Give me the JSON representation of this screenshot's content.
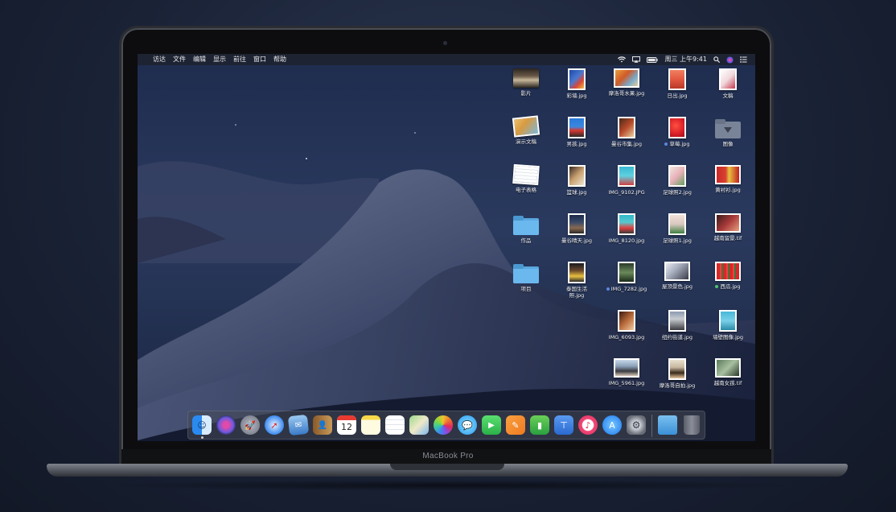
{
  "device": {
    "brand": "MacBook Pro"
  },
  "menubar": {
    "apple_icon": "apple-icon",
    "items": [
      "访达",
      "文件",
      "编辑",
      "显示",
      "前往",
      "窗口",
      "帮助"
    ],
    "status_icons": [
      "wifi-icon",
      "airplay-icon",
      "battery-icon"
    ],
    "clock": "周三 上午9:41",
    "right_icons": [
      "spotlight-icon",
      "siri-icon",
      "notification-center-icon"
    ]
  },
  "desktop": {
    "items": [
      {
        "label": "影片",
        "kind": "stack-movie"
      },
      {
        "label": "彩墙.jpg",
        "kind": "photo"
      },
      {
        "label": "摩洛哥水果.jpg",
        "kind": "photo"
      },
      {
        "label": "日出.jpg",
        "kind": "photo"
      },
      {
        "label": "文稿",
        "kind": "stack-docs"
      },
      {
        "label": "演示文稿",
        "kind": "stack-slides"
      },
      {
        "label": "男孩.jpg",
        "kind": "photo"
      },
      {
        "label": "曼谷市集.jpg",
        "kind": "photo"
      },
      {
        "label": "草莓.jpg",
        "kind": "photo",
        "tag": "#5a86e0"
      },
      {
        "label": "图像",
        "kind": "stack-images"
      },
      {
        "label": "电子表格",
        "kind": "stack-sheets"
      },
      {
        "label": "篮球.jpg",
        "kind": "photo"
      },
      {
        "label": "IMG_9102.JPG",
        "kind": "photo"
      },
      {
        "label": "足球照2.jpg",
        "kind": "photo"
      },
      {
        "label": "黄衬衫.jpg",
        "kind": "photo"
      },
      {
        "label": "作品",
        "kind": "folder"
      },
      {
        "label": "曼谷晴天.jpg",
        "kind": "photo"
      },
      {
        "label": "IMG_8120.jpg",
        "kind": "photo"
      },
      {
        "label": "足球照1.jpg",
        "kind": "photo"
      },
      {
        "label": "越南留景.tif",
        "kind": "photo"
      },
      {
        "label": "项目",
        "kind": "folder"
      },
      {
        "label": "泰国生活照.jpg",
        "kind": "photo"
      },
      {
        "label": "IMG_7282.jpg",
        "kind": "photo",
        "tag": "#5a86e0"
      },
      {
        "label": "屋顶景色.jpg",
        "kind": "photo"
      },
      {
        "label": "西瓜.jpg",
        "kind": "photo",
        "tag": "#4cc46a"
      },
      {
        "label": "IMG_6093.jpg",
        "kind": "photo"
      },
      {
        "label": "纽约街道.jpg",
        "kind": "photo"
      },
      {
        "label": "墙壁图像.jpg",
        "kind": "photo"
      },
      {
        "label": "IMG_5961.jpg",
        "kind": "photo"
      },
      {
        "label": "摩洛哥自拍.jpg",
        "kind": "photo"
      },
      {
        "label": "越南女孩.tif",
        "kind": "photo"
      }
    ]
  },
  "dock": {
    "apps": [
      "finder-icon",
      "siri-icon",
      "launchpad-icon",
      "safari-icon",
      "mail-icon",
      "contacts-icon",
      "calendar-icon",
      "notes-icon",
      "reminders-icon",
      "maps-icon",
      "photos-icon",
      "messages-icon",
      "facetime-icon",
      "pages-icon",
      "numbers-icon",
      "keynote-icon",
      "itunes-icon",
      "app-store-icon",
      "system-preferences-icon"
    ],
    "calendar_day": "12",
    "trailing": [
      "downloads-folder-icon",
      "trash-icon"
    ]
  },
  "colors": {
    "accent": "#3b8eea",
    "menubar": "#1e2028"
  }
}
